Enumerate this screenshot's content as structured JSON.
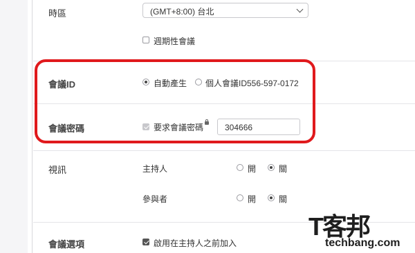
{
  "timezone": {
    "label": "時區",
    "value": "(GMT+8:00) 台北",
    "recurring_label": "週期性會議"
  },
  "meeting_id": {
    "label": "會議ID",
    "option_auto": "自動產生",
    "option_personal": "個人會議ID556-597-0172",
    "selected": "auto"
  },
  "meeting_password": {
    "label": "會議密碼",
    "require_label": "要求會議密碼",
    "require_checked": true,
    "value": "304666"
  },
  "video": {
    "label": "視訊",
    "host_label": "主持人",
    "participant_label": "參與者",
    "on_label": "開",
    "off_label": "關",
    "host_selected": "off",
    "participant_selected": "off"
  },
  "options": {
    "label": "會議選項",
    "join_before_host_label": "啟用在主持人之前加入",
    "join_before_host_checked": true
  },
  "watermark": {
    "glyphs": "T客邦",
    "text": "techbang.com"
  },
  "colors": {
    "highlight": "#e0191c",
    "background": "#ffffff"
  }
}
